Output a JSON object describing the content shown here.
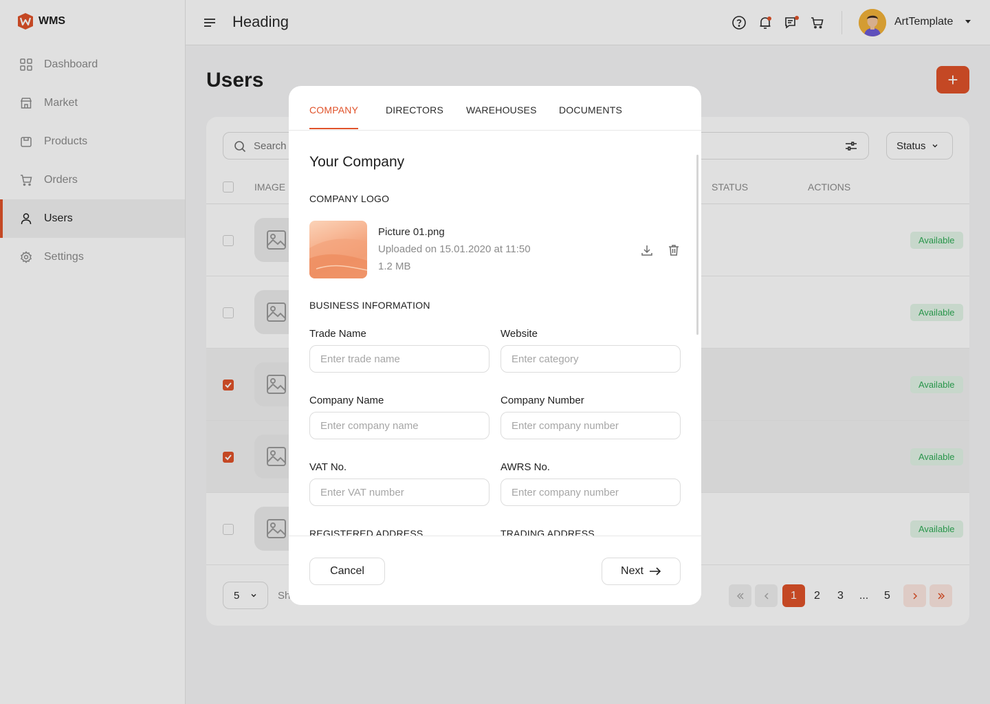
{
  "app": {
    "logo_text": "WMS"
  },
  "sidebar": {
    "items": [
      {
        "label": "Dashboard",
        "icon": "grid-icon"
      },
      {
        "label": "Market",
        "icon": "store-icon"
      },
      {
        "label": "Products",
        "icon": "box-icon"
      },
      {
        "label": "Orders",
        "icon": "cart-icon"
      },
      {
        "label": "Users",
        "icon": "user-icon",
        "active": true
      },
      {
        "label": "Settings",
        "icon": "gear-icon"
      }
    ]
  },
  "header": {
    "title": "Heading",
    "user_name": "ArtTemplate"
  },
  "main": {
    "page_title": "Users",
    "add_label": "+",
    "search_placeholder": "Search",
    "status_filter": "Status",
    "columns": {
      "image": "IMAGE",
      "status": "STATUS",
      "actions": "ACTIONS"
    },
    "rows": [
      {
        "status": "Available",
        "checked": false
      },
      {
        "status": "Available",
        "checked": false
      },
      {
        "status": "Available",
        "checked": true
      },
      {
        "status": "Available",
        "checked": true
      },
      {
        "status": "Available",
        "checked": false
      }
    ],
    "rows_per_page": "5",
    "showing_prefix": "Sh",
    "pagination": {
      "pages": [
        "1",
        "2",
        "3",
        "...",
        "5"
      ],
      "current": "1"
    }
  },
  "modal": {
    "tabs": [
      "COMPANY",
      "DIRECTORS",
      "WAREHOUSES",
      "DOCUMENTS"
    ],
    "active_tab": "COMPANY",
    "title": "Your Company",
    "logo_section": "COMPANY LOGO",
    "file": {
      "name": "Picture 01.png",
      "uploaded": "Uploaded on 15.01.2020 at 11:50",
      "size": "1.2 MB"
    },
    "business_section": "BUSINESS INFORMATION",
    "fields": {
      "trade_name": {
        "label": "Trade Name",
        "placeholder": "Enter trade name"
      },
      "website": {
        "label": "Website",
        "placeholder": "Enter category"
      },
      "company_name": {
        "label": "Company Name",
        "placeholder": "Enter company name"
      },
      "company_number": {
        "label": "Company Number",
        "placeholder": "Enter company number"
      },
      "vat": {
        "label": "VAT No.",
        "placeholder": "Enter VAT number"
      },
      "awrs": {
        "label": "AWRS No.",
        "placeholder": "Enter company number"
      }
    },
    "registered_address": "REGISTERED ADDRESS",
    "trading_address": "TRADING ADDRESS",
    "cancel_label": "Cancel",
    "next_label": "Next"
  },
  "colors": {
    "accent": "#e0522a",
    "success_bg": "#e3f5e8",
    "success_text": "#2eaa55"
  }
}
